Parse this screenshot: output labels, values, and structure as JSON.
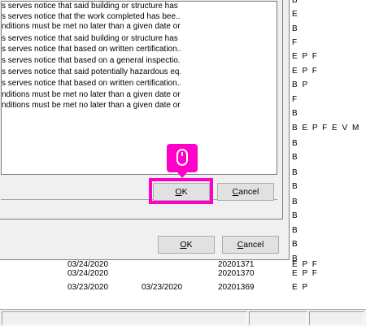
{
  "inner_dialog": {
    "list_items": [
      "s serves notice that said building or structure has",
      "s serves notice that the work completed has bee...",
      "nditions must be met no later than a given date or...",
      "s serves notice that said building or structure has",
      "s serves notice that based on written certification...",
      "s serves notice that based on a general inspectio...",
      "s serves notice that said potentially hazardous eq...",
      "s serves notice that based on written certification...",
      "nditions must be met no later than a given date or...",
      "nditions must be met no later than a given date or..."
    ],
    "ok_button": {
      "label": "OK",
      "mnemonic": "O",
      "rest": "K"
    },
    "cancel_button": {
      "label": "Cancel",
      "mnemonic": "C",
      "rest": "ancel"
    }
  },
  "outer_dialog": {
    "ok_button": {
      "label": "OK",
      "mnemonic": "O",
      "rest": "K"
    },
    "cancel_button": {
      "label": "Cancel",
      "mnemonic": "C",
      "rest": "ancel"
    }
  },
  "background_codes": [
    "B",
    "E",
    "B",
    "F",
    "E P F",
    "E P F",
    "B P",
    "F",
    "B",
    "B E P F E V M",
    "B",
    "B",
    "B",
    "B",
    "B",
    "B",
    "B",
    "B",
    "B",
    "E P F",
    "E P F"
  ],
  "background_rows": [
    {
      "date1": "03/24/2020",
      "date2": "",
      "number": "20201371",
      "codes": "E P F"
    },
    {
      "date1": "03/24/2020",
      "date2": "",
      "number": "20201370",
      "codes": "E P F"
    },
    {
      "date1": "03/23/2020",
      "date2": "03/23/2020",
      "number": "20201369",
      "codes": "E P"
    }
  ],
  "callout": {
    "icon": "mouse-icon",
    "color": "#ff00c8"
  },
  "highlight_color": "#ff00c8"
}
